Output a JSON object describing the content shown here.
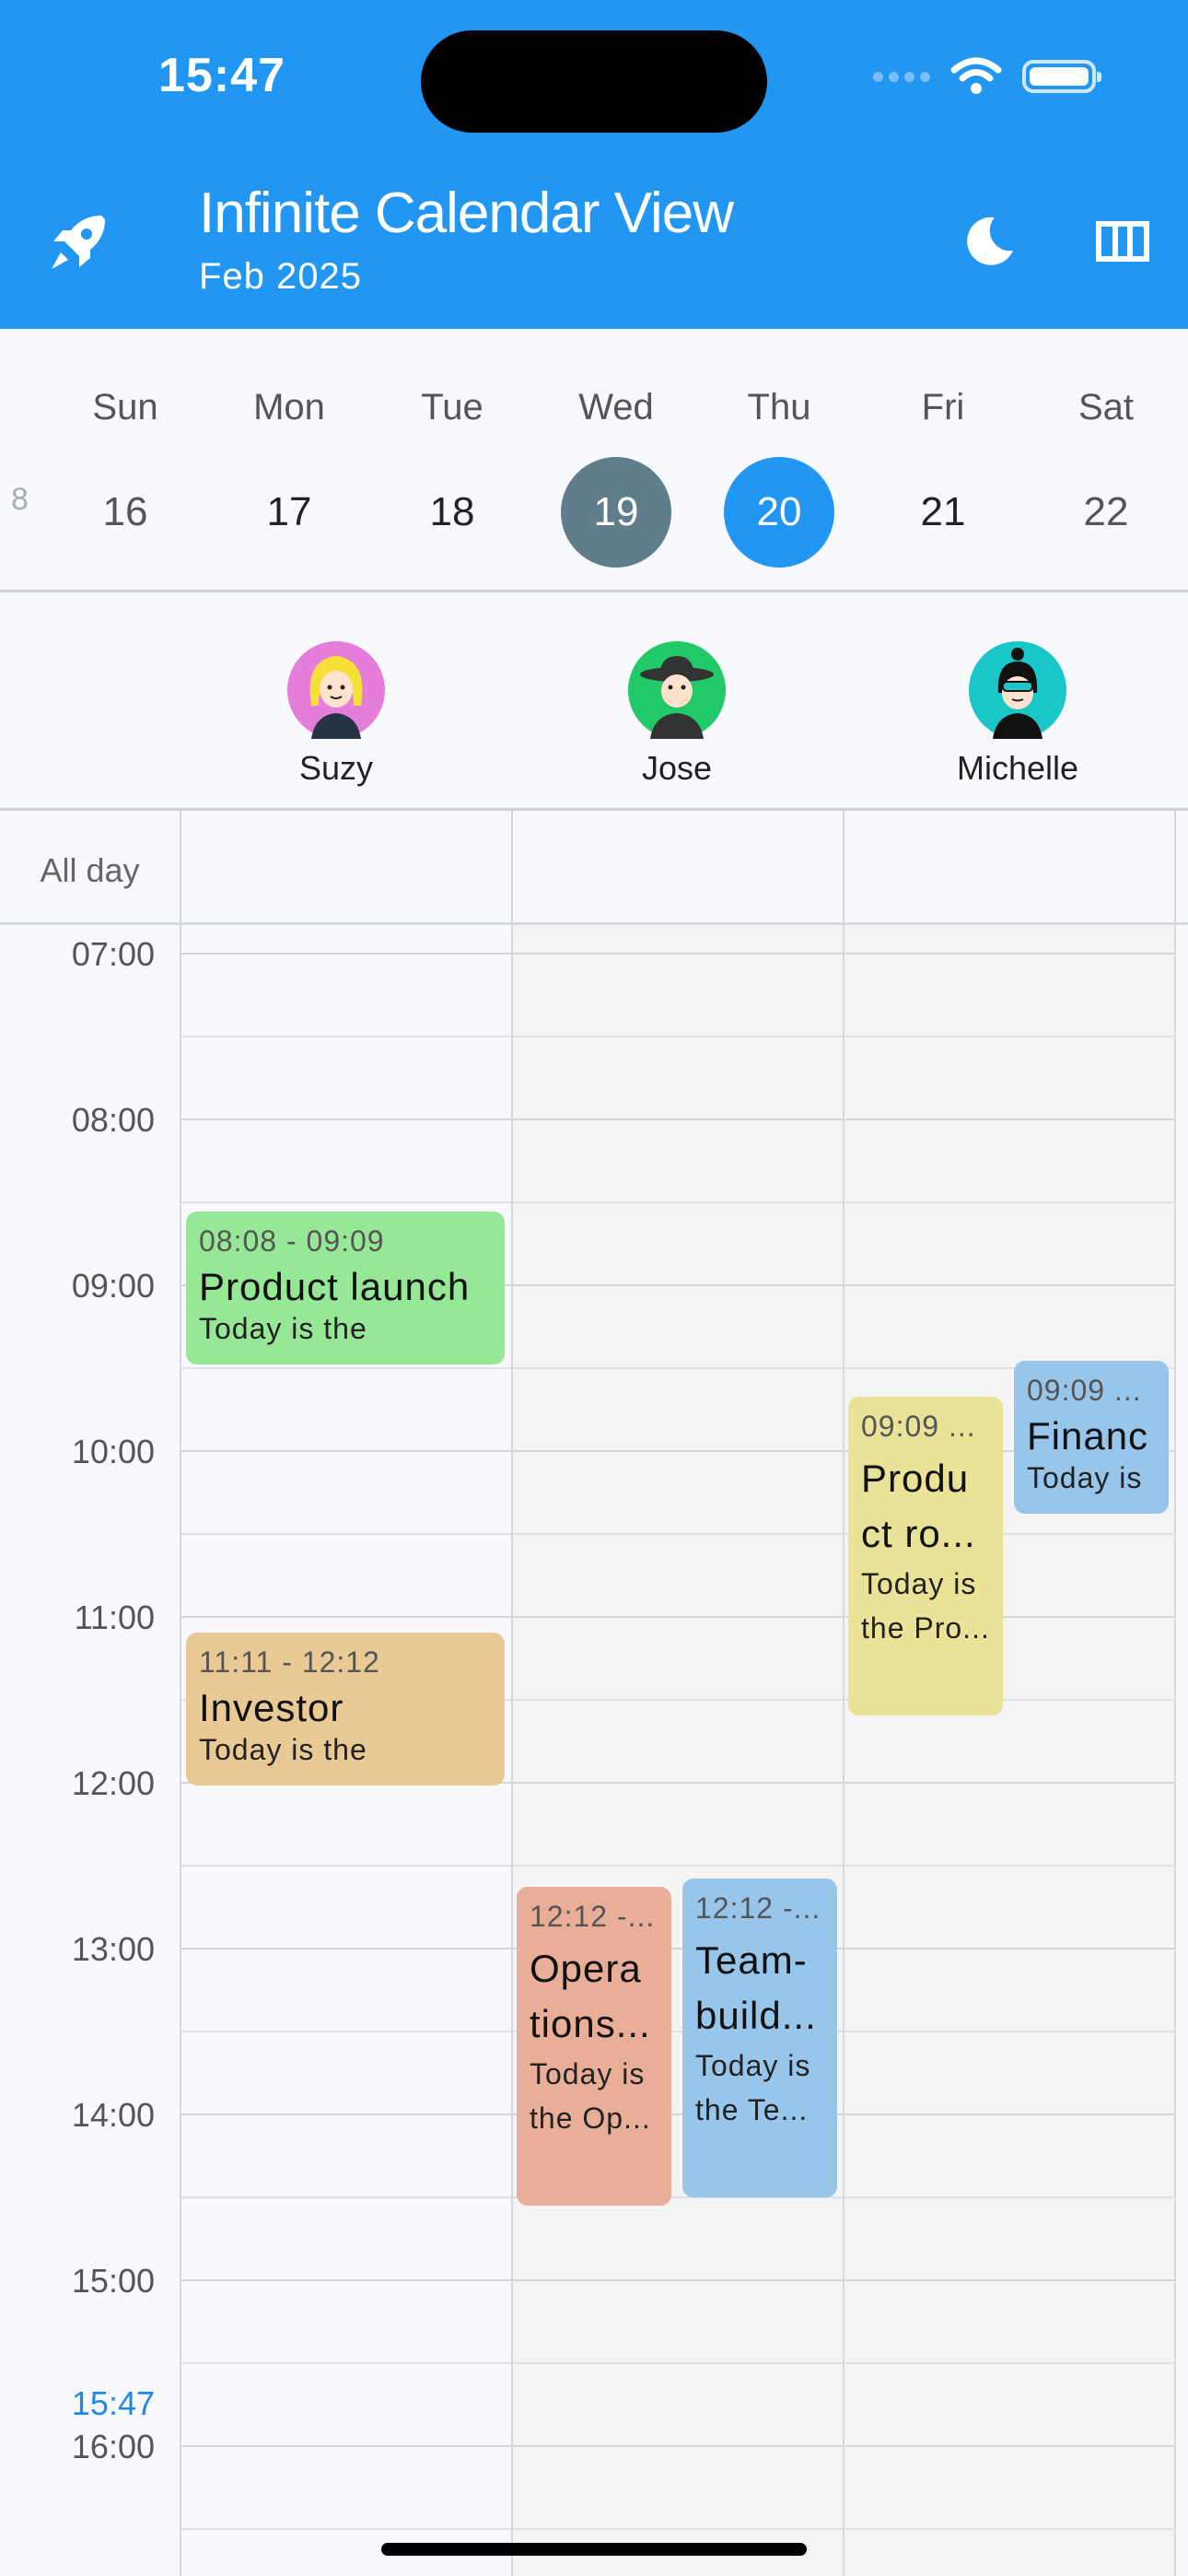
{
  "status": {
    "time": "15:47"
  },
  "header": {
    "title": "Infinite Calendar View",
    "subtitle": "Feb 2025"
  },
  "icons": {
    "left": "rocket-icon",
    "right1": "moon-icon",
    "right2": "view-columns-icon"
  },
  "week": {
    "prev_partial": "8",
    "days": [
      {
        "name": "Sun",
        "date": "16"
      },
      {
        "name": "Mon",
        "date": "17"
      },
      {
        "name": "Tue",
        "date": "18"
      },
      {
        "name": "Wed",
        "date": "19",
        "state": "selected"
      },
      {
        "name": "Thu",
        "date": "20",
        "state": "today"
      },
      {
        "name": "Fri",
        "date": "21"
      },
      {
        "name": "Sat",
        "date": "22"
      }
    ]
  },
  "people": [
    {
      "name": "Suzy",
      "color": "#e57edb"
    },
    {
      "name": "Jose",
      "color": "#21c968"
    },
    {
      "name": "Michelle",
      "color": "#19c7c9"
    }
  ],
  "allday_label": "All day",
  "hours": [
    "07:00",
    "08:00",
    "09:00",
    "10:00",
    "11:00",
    "12:00",
    "13:00",
    "14:00",
    "15:00",
    "16:00"
  ],
  "now_label": "15:47",
  "events": [
    {
      "time": "08:08 - 09:09",
      "name": "Product launch",
      "desc": "Today is the",
      "color": "#97e896"
    },
    {
      "time": "11:11 - 12:12",
      "name": "Investor",
      "desc": "Today is the",
      "color": "#e9c994"
    },
    {
      "time": "12:12 -...",
      "name": "Opera tions...",
      "desc": "Today is the Op...",
      "color": "#e9ae98"
    },
    {
      "time": "12:12 -...",
      "name": "Team- build...",
      "desc": "Today is the Te...",
      "color": "#98c5ea"
    },
    {
      "time": "09:09 ...",
      "name": "Produ ct ro...",
      "desc": "Today is the Pro...",
      "color": "#e9e297"
    },
    {
      "time": "09:09 ...",
      "name": "Financ",
      "desc": "Today is",
      "color": "#98c5ea"
    }
  ],
  "colors": {
    "primary": "#2196f3",
    "selected_day": "#607d8b"
  }
}
